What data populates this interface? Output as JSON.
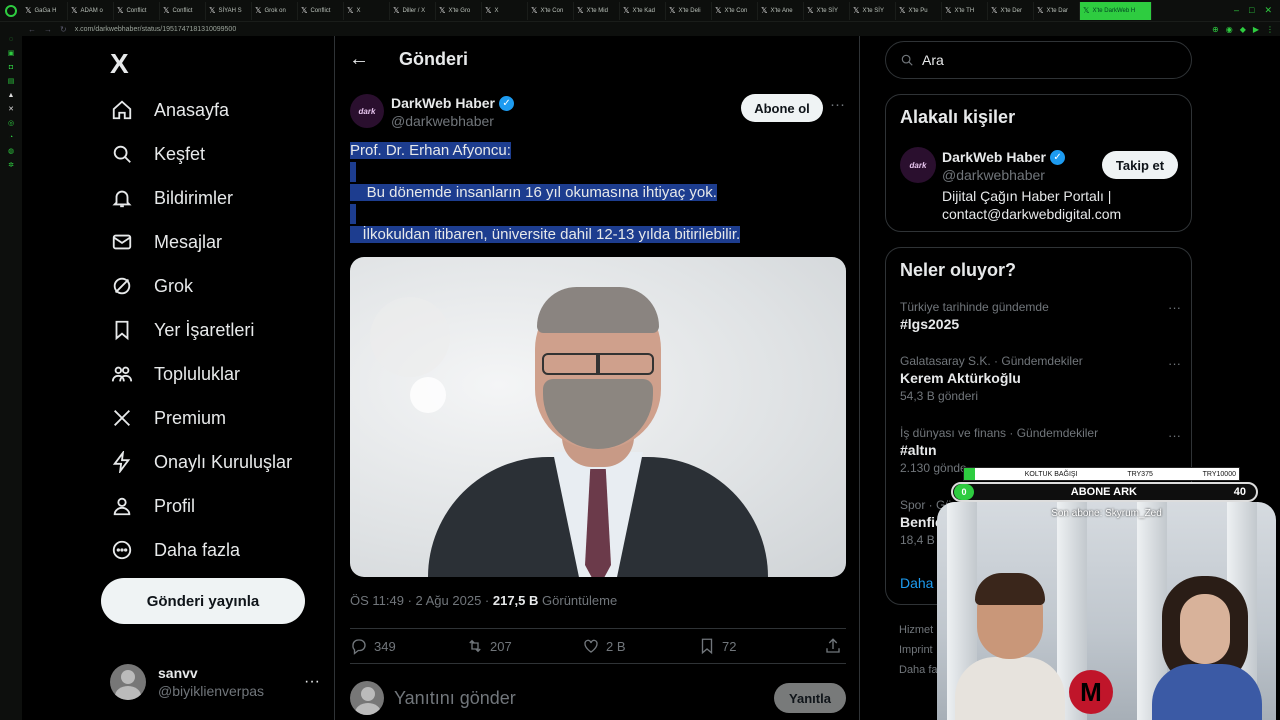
{
  "browser": {
    "url": "x.com/darkwebhaber/status/1951747181310099500",
    "tabs": [
      {
        "label": "GaGa H",
        "active": false
      },
      {
        "label": "ADAM o",
        "active": false
      },
      {
        "label": "Conflict",
        "active": false
      },
      {
        "label": "Conflict",
        "active": false
      },
      {
        "label": "SİYAH S",
        "active": false
      },
      {
        "label": "Grok on",
        "active": false
      },
      {
        "label": "Conflict",
        "active": false
      },
      {
        "label": "X",
        "active": false
      },
      {
        "label": "Diller / X",
        "active": false
      },
      {
        "label": "X'te Gro",
        "active": false
      },
      {
        "label": "X",
        "active": false
      },
      {
        "label": "X'te Con",
        "active": false
      },
      {
        "label": "X'te Mid",
        "active": false
      },
      {
        "label": "X'te Kad",
        "active": false
      },
      {
        "label": "X'te Deli",
        "active": false
      },
      {
        "label": "X'te Con",
        "active": false
      },
      {
        "label": "X'te Ane",
        "active": false
      },
      {
        "label": "X'te SİY",
        "active": false
      },
      {
        "label": "X'te SİY",
        "active": false
      },
      {
        "label": "X'te Pu",
        "active": false
      },
      {
        "label": "X'te TH",
        "active": false
      },
      {
        "label": "X'te Der",
        "active": false
      },
      {
        "label": "X'te Dar",
        "active": false
      },
      {
        "label": "X'te DarkWeb H",
        "active": true
      }
    ]
  },
  "nav": {
    "logo": "X",
    "items": [
      {
        "label": "Anasayfa",
        "icon": "home-icon"
      },
      {
        "label": "Keşfet",
        "icon": "search-icon"
      },
      {
        "label": "Bildirimler",
        "icon": "bell-icon"
      },
      {
        "label": "Mesajlar",
        "icon": "mail-icon"
      },
      {
        "label": "Grok",
        "icon": "grok-icon"
      },
      {
        "label": "Yer İşaretleri",
        "icon": "bookmark-icon"
      },
      {
        "label": "Topluluklar",
        "icon": "communities-icon"
      },
      {
        "label": "Premium",
        "icon": "x-premium-icon"
      },
      {
        "label": "Onaylı Kuruluşlar",
        "icon": "lightning-icon"
      },
      {
        "label": "Profil",
        "icon": "person-icon"
      },
      {
        "label": "Daha fazla",
        "icon": "more-circle-icon"
      }
    ],
    "post_button": "Gönderi yayınla",
    "account": {
      "name": "sanvv",
      "handle": "@biyiklienverpas",
      "more": "···"
    }
  },
  "main": {
    "title": "Gönderi",
    "author": {
      "name": "DarkWeb Haber",
      "handle": "@darkwebhaber",
      "avatar_text": "dark"
    },
    "follow_label": "Abone ol",
    "more": "···",
    "text": {
      "line1": "Prof. Dr. Erhan Afyoncu:",
      "line2": "Bu dönemde insanların 16 yıl okumasına ihtiyaç yok.",
      "line3": "İlkokuldan itibaren, üniversite dahil 12-13 yılda bitirilebilir."
    },
    "meta": {
      "time": "ÖS 11:49 · 2 Ağu 2025 · ",
      "views": "217,5 B",
      "views_label": " Görüntüleme"
    },
    "actions": {
      "replies": "349",
      "reposts": "207",
      "likes": "2 B",
      "bookmarks": "72"
    },
    "reply": {
      "placeholder": "Yanıtını gönder",
      "button": "Yanıtla"
    }
  },
  "right": {
    "search_placeholder": "Ara",
    "related": {
      "title": "Alakalı kişiler",
      "name": "DarkWeb Haber",
      "handle": "@darkwebhaber",
      "bio": "Dijital Çağın Haber Portalı | contact@darkwebdigital.com",
      "follow": "Takip et",
      "avatar_text": "dark"
    },
    "trends": {
      "title": "Neler oluyor?",
      "items": [
        {
          "category": "Türkiye tarihinde gündemde",
          "name": "#lgs2025",
          "count": ""
        },
        {
          "category": "Galatasaray S.K. · Gündemdekiler",
          "name": "Kerem Aktürkoğlu",
          "count": "54,3 B gönderi"
        },
        {
          "category": "İş dünyası ve finans · Gündemdekiler",
          "name": "#altın",
          "count": "2.130 gönde"
        },
        {
          "category": "Spor · Gü",
          "name": "Benfic",
          "count": "18,4 B"
        }
      ],
      "show_more": "Daha f"
    },
    "footer": [
      "Hizmet",
      "Imprint",
      "Daha fa"
    ]
  },
  "overlay": {
    "bar_label": "KOLTUK BAĞIŞI",
    "bar_current": "TRY375",
    "bar_goal": "TRY10000",
    "bar_progress": 0.04,
    "pill_count": "0",
    "pill_label": "ABONE ARK",
    "pill_goal": "40",
    "last_sub": "Son abone: Skyrum_Zed",
    "logo": "M"
  }
}
